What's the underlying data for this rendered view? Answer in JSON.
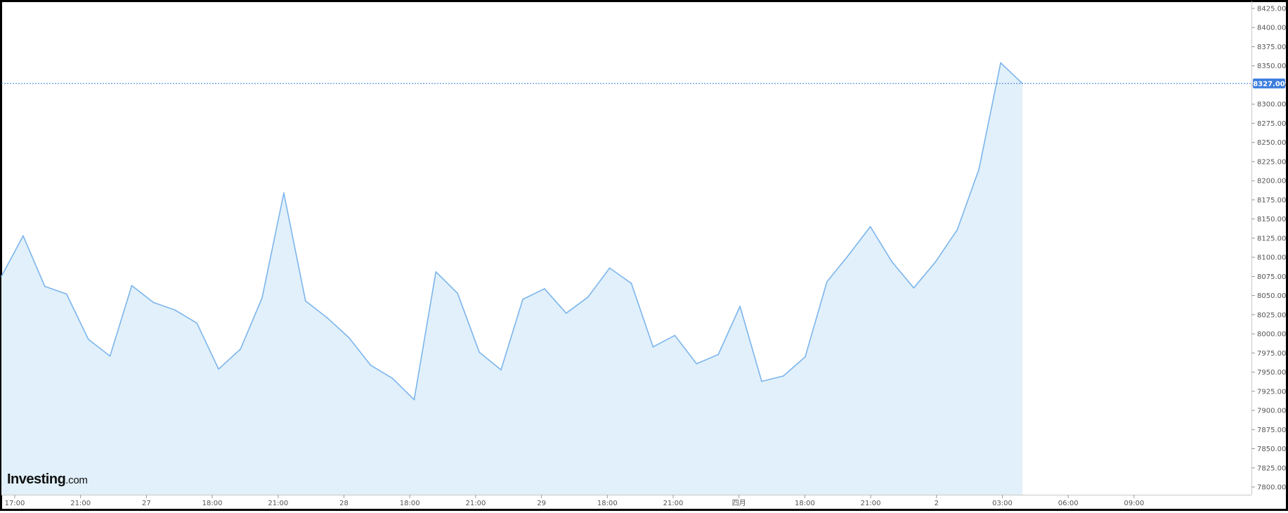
{
  "logo": {
    "brand": "Investing",
    "suffix": ".com"
  },
  "colors": {
    "line": "#7cb5ec",
    "fill": "#e1f0fa",
    "current_price_line": "#3b7ddd",
    "current_price_badge": "#3b7ddd",
    "border": "#000000"
  },
  "chart_data": {
    "type": "area",
    "title": "",
    "xlabel": "",
    "ylabel": "",
    "ylim": [
      7800,
      8425
    ],
    "grid": false,
    "y_axis_side": "right",
    "y_ticks": [
      "8425.00",
      "8400.00",
      "8375.00",
      "8350.00",
      "8325.00",
      "8300.00",
      "8275.00",
      "8250.00",
      "8225.00",
      "8200.00",
      "8175.00",
      "8150.00",
      "8125.00",
      "8100.00",
      "8075.00",
      "8050.00",
      "8025.00",
      "8000.00",
      "7975.00",
      "7950.00",
      "7925.00",
      "7900.00",
      "7875.00",
      "7850.00",
      "7825.00",
      "7800.00"
    ],
    "x_ticks": [
      "17:00",
      "21:00",
      "27",
      "18:00",
      "21:00",
      "28",
      "18:00",
      "21:00",
      "29",
      "18:00",
      "21:00",
      "四月",
      "18:00",
      "21:00",
      "2",
      "03:00",
      "06:00",
      "09:00"
    ],
    "current_value": 8327.0,
    "current_value_label": "8327.00",
    "series": [
      {
        "values": [
          8075,
          8128,
          8062,
          8052,
          7993,
          7971,
          8063,
          8041,
          8031,
          8014,
          7954,
          7980,
          8047,
          8184,
          8043,
          8021,
          7995,
          7959,
          7942,
          7914,
          8081,
          8053,
          7976,
          7953,
          8045,
          8059,
          8027,
          8048,
          8086,
          8066,
          7983,
          7998,
          7961,
          7973,
          8036,
          7938,
          7945,
          7970,
          8068,
          8103,
          8140,
          8094,
          8060,
          8094,
          8136,
          8215,
          8354,
          8327
        ]
      }
    ]
  }
}
